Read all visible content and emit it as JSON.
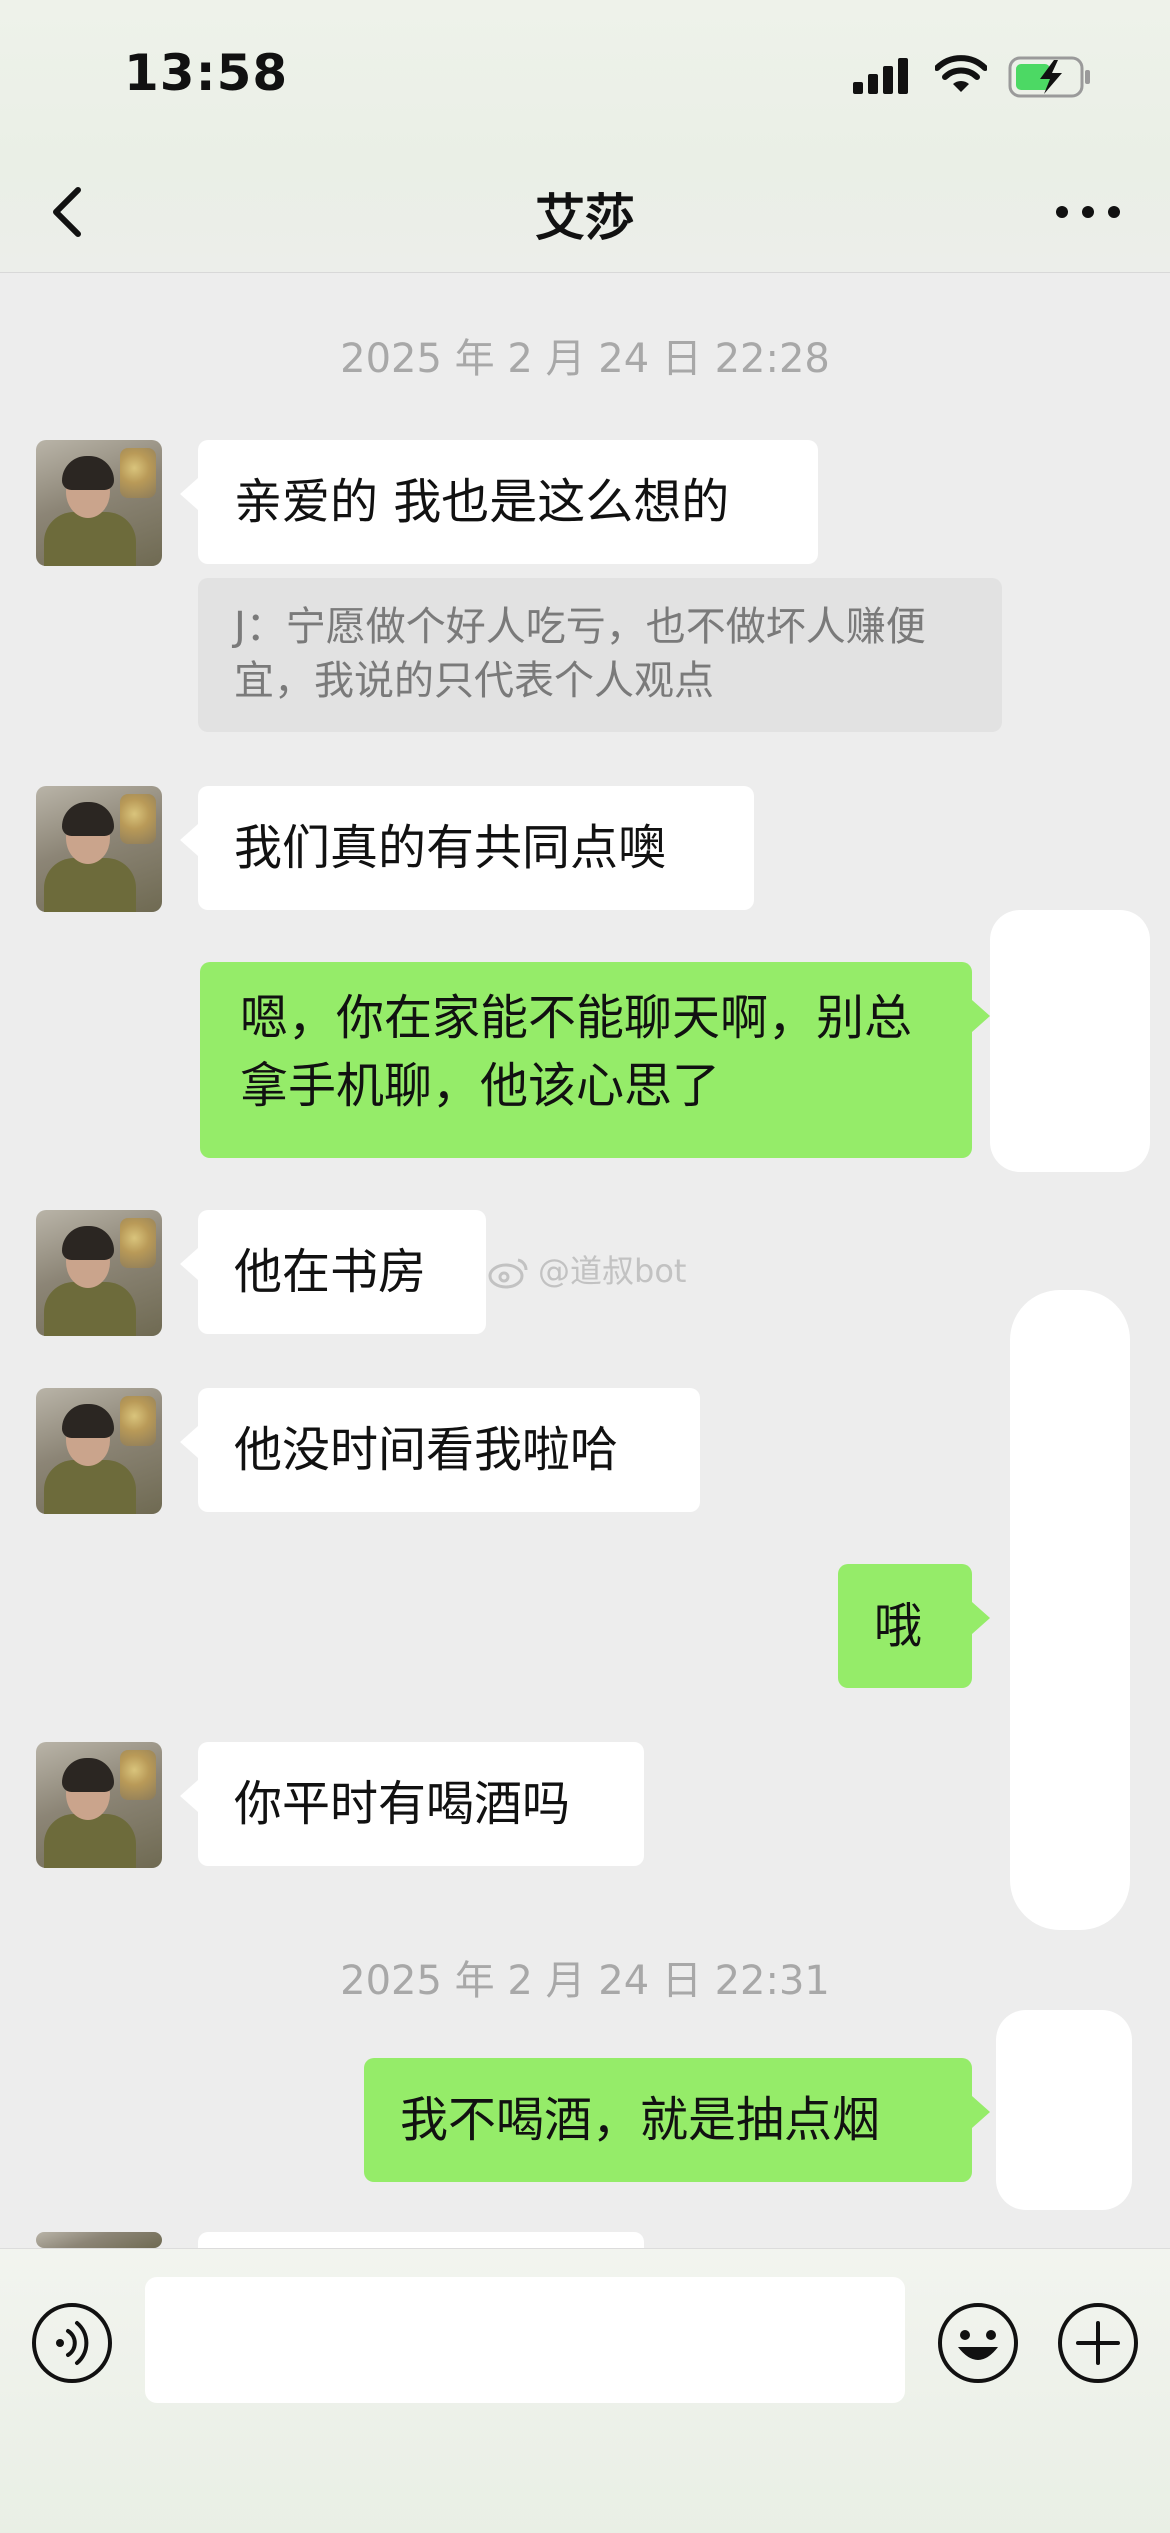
{
  "status_bar": {
    "time": "13:58",
    "battery_color": "#4cd964"
  },
  "nav": {
    "title": "艾莎",
    "back_icon": "chevron-left-icon",
    "more_icon": "more-dots-icon"
  },
  "chat": {
    "timestamps": [
      "2025 年 2 月 24 日 22:28",
      "2025 年 2 月 24 日 22:31"
    ],
    "messages": [
      {
        "side": "in",
        "text": "亲爱的 我也是这么想的"
      },
      {
        "side": "in",
        "text": "我们真的有共同点噢"
      },
      {
        "side": "out",
        "text": "嗯，你在家能不能聊天啊，别总拿手机聊，他该心思了"
      },
      {
        "side": "in",
        "text": "他在书房"
      },
      {
        "side": "in",
        "text": "他没时间看我啦哈"
      },
      {
        "side": "out",
        "text": "哦"
      },
      {
        "side": "in",
        "text": "你平时有喝酒吗"
      },
      {
        "side": "out",
        "text": "我不喝酒，就是抽点烟"
      }
    ],
    "quote": "J：宁愿做个好人吃亏，也不做坏人赚便宜，我说的只代表个人观点",
    "watermark": "@道叔bot",
    "bubble_out_color": "#95ec69",
    "bubble_in_color": "#ffffff"
  },
  "input_bar": {
    "value": "",
    "voice_icon": "voice-icon",
    "emoji_icon": "emoji-icon",
    "plus_icon": "plus-icon"
  }
}
